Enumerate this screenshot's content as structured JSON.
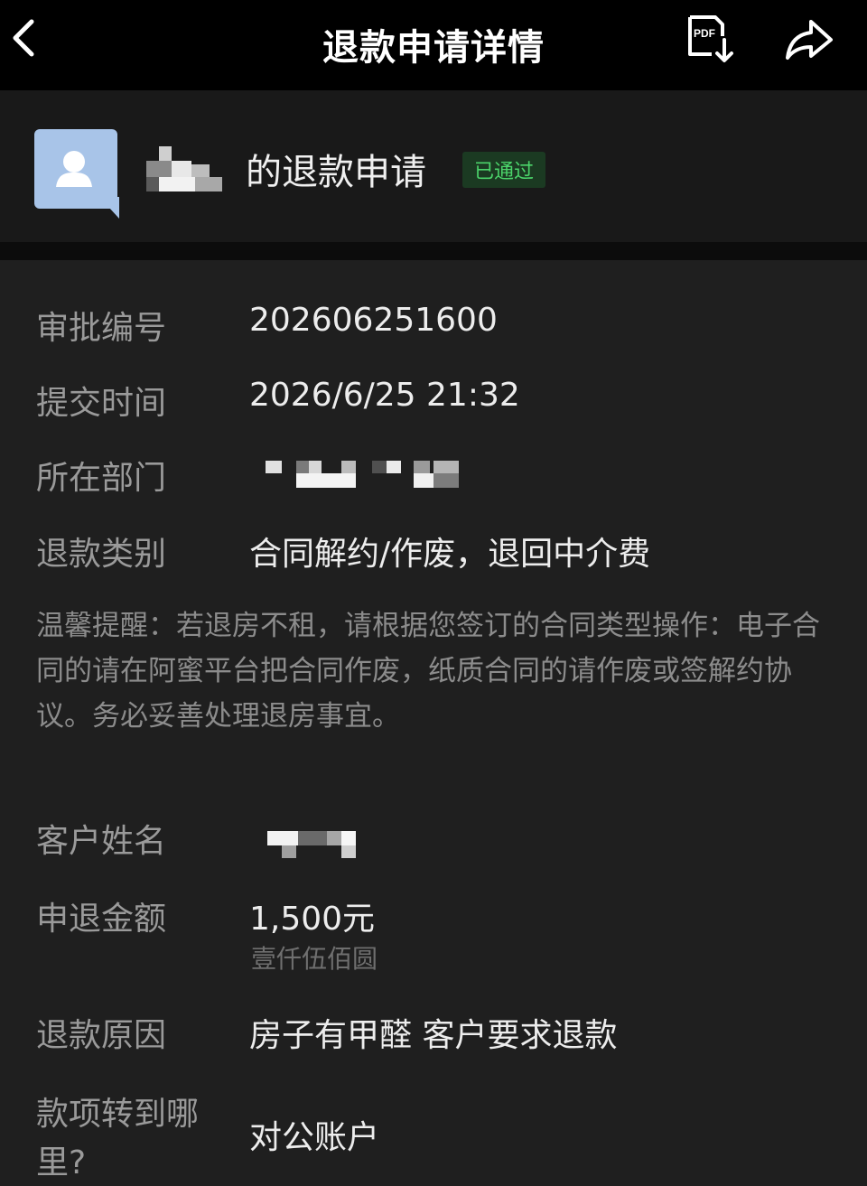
{
  "header": {
    "title": "退款申请详情",
    "pdf_label": "PDF"
  },
  "request": {
    "title_suffix": "的退款申请",
    "status": "已通过"
  },
  "details": {
    "approval_no_label": "审批编号",
    "approval_no": "202606251600",
    "submit_time_label": "提交时间",
    "submit_time": "2026/6/25 21:32",
    "department_label": "所在部门",
    "refund_type_label": "退款类别",
    "refund_type": "合同解约/作废，退回中介费",
    "tip": "温馨提醒：若退房不租，请根据您签订的合同类型操作：电子合同的请在阿蜜平台把合同作废，纸质合同的请作废或签解约协议。务必妥善处理退房事宜。",
    "customer_name_label": "客户姓名",
    "amount_label": "申退金额",
    "amount": "1,500元",
    "amount_chinese": "壹仟伍佰圆",
    "reason_label": "退款原因",
    "reason": "房子有甲醛 客户要求退款",
    "transfer_label_1": "款项转到哪",
    "transfer_label_2": "里?",
    "transfer_value": "对公账户"
  },
  "colors": {
    "status_text": "#4bd36a",
    "status_bg": "#1b3a22",
    "avatar": "#a8c4e8"
  }
}
